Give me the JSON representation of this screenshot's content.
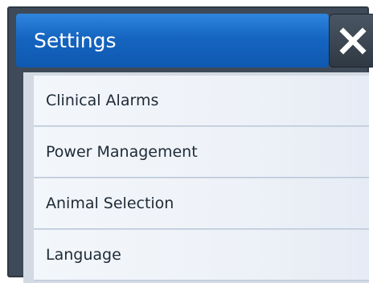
{
  "dialog": {
    "title": "Settings",
    "close_icon": "close-x-icon",
    "colors": {
      "title_bar": "#1565c0",
      "frame": "#3e4a57",
      "item_bg": "#eef2f8"
    }
  },
  "menu": {
    "items": [
      {
        "label": "Clinical Alarms"
      },
      {
        "label": "Power Management"
      },
      {
        "label": "Animal Selection"
      },
      {
        "label": "Language"
      }
    ]
  }
}
